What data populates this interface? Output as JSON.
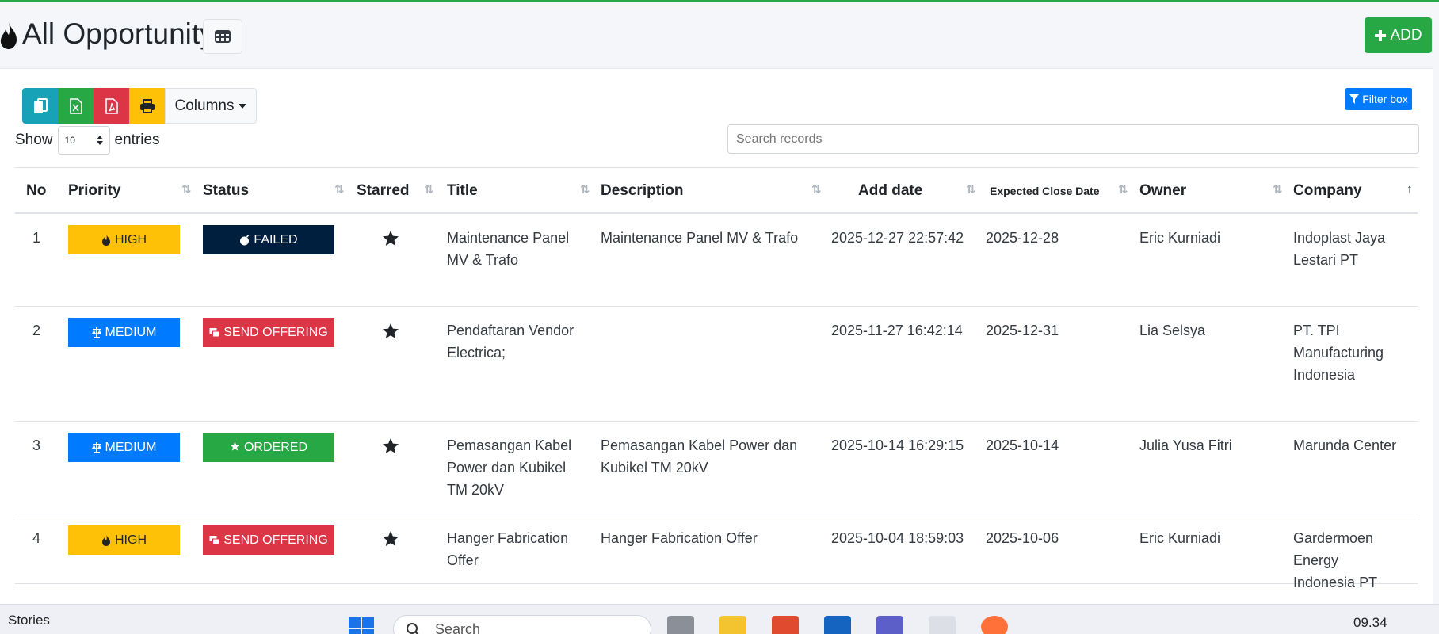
{
  "header": {
    "title": "All Opportunity",
    "add_label": "ADD",
    "logo_icon": "fire-icon",
    "view_icon": "table-icon"
  },
  "toolbar": {
    "buttons": [
      {
        "name": "copy",
        "icon": "copy-icon",
        "color": "#17a2b8"
      },
      {
        "name": "excel",
        "icon": "file-excel-icon",
        "color": "#28a745"
      },
      {
        "name": "pdf",
        "icon": "file-pdf-icon",
        "color": "#dc3545"
      },
      {
        "name": "print",
        "icon": "print-icon",
        "color": "#ffc107"
      }
    ],
    "columns_label": "Columns",
    "filter_label": "Filter box"
  },
  "length": {
    "show_label": "Show",
    "value": "10",
    "entries_label": "entries"
  },
  "search": {
    "placeholder": "Search records"
  },
  "table": {
    "columns": [
      "No",
      "Priority",
      "Status",
      "Starred",
      "Title",
      "Description",
      "Add date",
      "Expected Close Date",
      "Owner",
      "Company"
    ],
    "rows": [
      {
        "no": "1",
        "priority": "HIGH",
        "priority_color": "#ffc107",
        "priority_icon": "fire-icon",
        "status": "FAILED",
        "status_color": "#001f3f",
        "status_icon": "bomb-icon",
        "starred": true,
        "title_lines": [
          "Maintenance Panel",
          "MV & Trafo"
        ],
        "desc_lines": [
          "Maintenance Panel MV & Trafo"
        ],
        "add_date": "2025-12-27 22:57:42",
        "close_date": "2025-12-28",
        "owner": "Eric Kurniadi",
        "company_lines": [
          "Indoplast Jaya",
          "Lestari PT"
        ]
      },
      {
        "no": "2",
        "priority": "MEDIUM",
        "priority_color": "#007bff",
        "priority_icon": "balance-scale-icon",
        "status": "SEND OFFERING",
        "status_color": "#dc3545",
        "status_icon": "mail-bulk-icon",
        "starred": true,
        "title_lines": [
          "Pendaftaran Vendor",
          "Electrica;"
        ],
        "desc_lines": [],
        "add_date": "2025-11-27 16:42:14",
        "close_date": "2025-12-31",
        "owner": "Lia Selsya",
        "company_lines": [
          "PT. TPI",
          "Manufacturing",
          "Indonesia"
        ]
      },
      {
        "no": "3",
        "priority": "MEDIUM",
        "priority_color": "#007bff",
        "priority_icon": "balance-scale-icon",
        "status": "ORDERED",
        "status_color": "#28a745",
        "status_icon": "star-icon",
        "starred": true,
        "title_lines": [
          "Pemasangan Kabel",
          "Power dan Kubikel",
          "TM 20kV"
        ],
        "desc_lines": [
          "Pemasangan Kabel Power dan",
          "Kubikel TM 20kV"
        ],
        "add_date": "2025-10-14 16:29:15",
        "close_date": "2025-10-14",
        "owner": "Julia Yusa Fitri",
        "company_lines": [
          "Marunda Center"
        ]
      },
      {
        "no": "4",
        "priority": "HIGH",
        "priority_color": "#ffc107",
        "priority_icon": "fire-icon",
        "status": "SEND OFFERING",
        "status_color": "#dc3545",
        "status_icon": "mail-bulk-icon",
        "starred": true,
        "title_lines": [
          "Hanger Fabrication",
          "Offer"
        ],
        "desc_lines": [
          "Hanger Fabrication Offer"
        ],
        "add_date": "2025-10-04 18:59:03",
        "close_date": "2025-10-06",
        "owner": "Eric Kurniadi",
        "company_lines": [
          "Gardermoen Energy",
          "Indonesia PT"
        ]
      }
    ]
  },
  "taskbar": {
    "left_label": "Stories",
    "search_placeholder": "Search",
    "time": "09.34"
  }
}
